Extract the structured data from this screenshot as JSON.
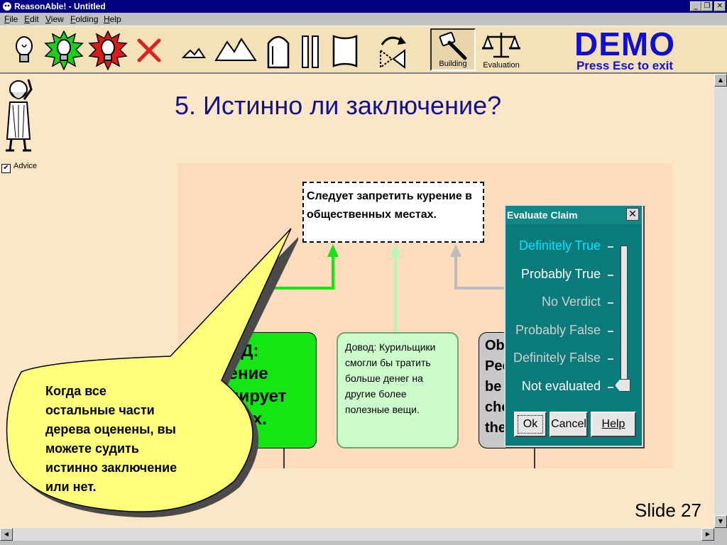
{
  "window": {
    "title": "ReasonAble! - Untitled"
  },
  "menu": [
    "File",
    "Edit",
    "View",
    "Folding",
    "Help"
  ],
  "toolbar": {
    "tools": [
      "lightbulb-icon",
      "green-lightbulb-icon",
      "red-lightbulb-icon",
      "delete-x-icon",
      "small-hills-icon",
      "mountains-icon",
      "gravestone-icon",
      "pillars-icon",
      "scroll-icon",
      "rotate-arrow-icon"
    ],
    "building_label": "Building",
    "evaluation_label": "Evaluation"
  },
  "demo": {
    "title": "DEMO",
    "subtitle": "Press Esc to exit"
  },
  "advice": {
    "label": "Advice",
    "checked": true
  },
  "slide": {
    "title": "5. Истинно ли заключение?",
    "number": "Slide 27"
  },
  "diagram": {
    "claim_lines": [
      "Следует запретить курение в",
      "общественных местах."
    ],
    "node1_lines": [
      "ОД:",
      "рение",
      "ицирует",
      "их."
    ],
    "node2_lines": [
      "Довод: Курильщики",
      "смогли бы тратить",
      "больше денег на",
      "другие более",
      "полезные вещи."
    ],
    "node3_lines": [
      "Obj",
      "Peo",
      "be",
      "cho",
      "the"
    ]
  },
  "balloon": {
    "lines": [
      "Когда все",
      "остальные части",
      "дерева оценены, вы",
      "можете судить",
      "истинно заключение",
      "или нет."
    ]
  },
  "evaluate_dialog": {
    "title": "Evaluate Claim",
    "options": [
      {
        "label": "Definitely True",
        "color": "#00e5ff"
      },
      {
        "label": "Probably True",
        "color": "#ffffff"
      },
      {
        "label": "No Verdict",
        "color": "#d0d0d0"
      },
      {
        "label": "Probably False",
        "color": "#d0d0d0"
      },
      {
        "label": "Definitely False",
        "color": "#d0d0d0"
      },
      {
        "label": "Not evaluated",
        "color": "#ffffff"
      }
    ],
    "selected": "Not evaluated",
    "ok_label": "Ok",
    "cancel_label": "Cancel",
    "help_label": "Help"
  }
}
